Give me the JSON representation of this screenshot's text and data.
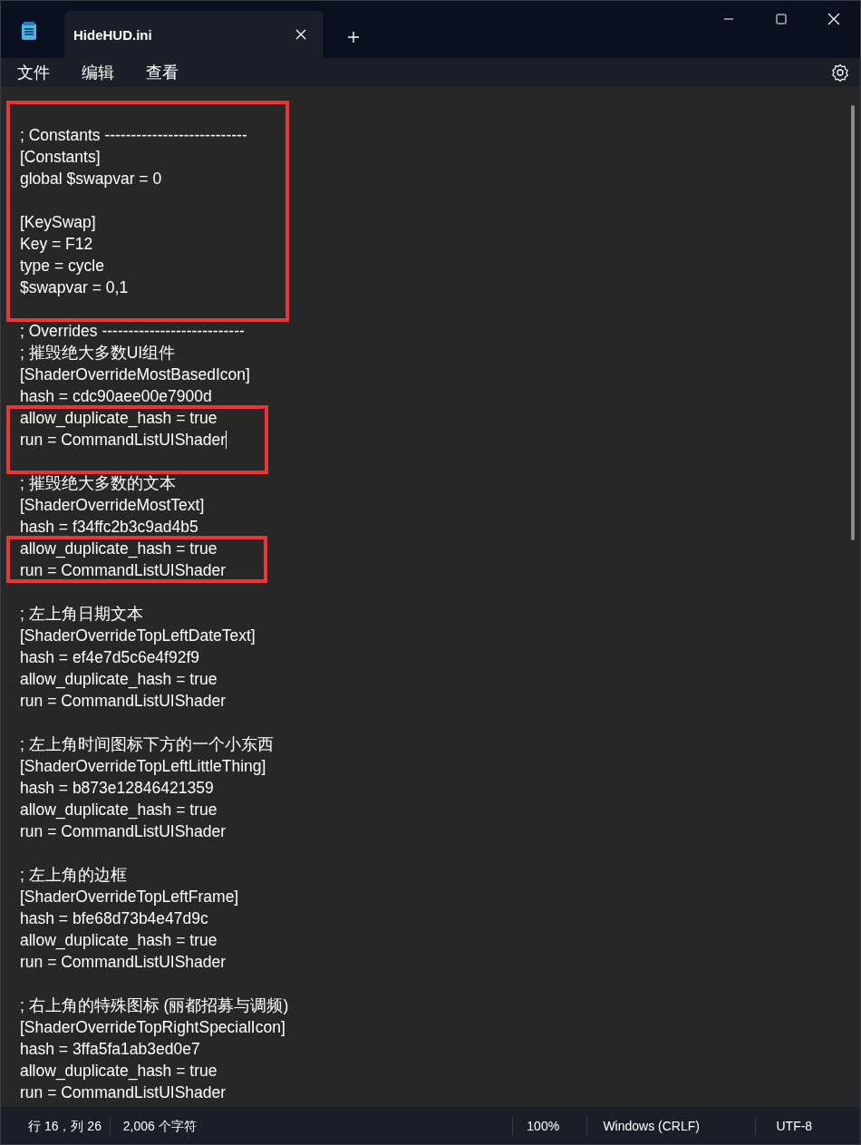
{
  "window": {
    "tabs": [
      {
        "label": "HideHUD.ini",
        "selected": true
      }
    ]
  },
  "menu": [
    "文件",
    "编辑",
    "查看"
  ],
  "editor": {
    "blocks": [
      {
        "highlighted": true,
        "lines": [
          {
            "kind": "blank"
          },
          {
            "kind": "text",
            "text": "; Constants ---------------------------"
          },
          {
            "kind": "text",
            "text": "[Constants]"
          },
          {
            "kind": "text",
            "text": "global $swapvar = 0"
          },
          {
            "kind": "blank"
          },
          {
            "kind": "text",
            "text": "[KeySwap]"
          },
          {
            "kind": "text",
            "text": "Key = F12"
          },
          {
            "kind": "text",
            "text": "type = cycle"
          },
          {
            "kind": "text",
            "text": "$swapvar = 0,1"
          },
          {
            "kind": "blank"
          }
        ]
      },
      {
        "highlighted": false,
        "lines": [
          {
            "kind": "text",
            "text": "; Overrides ---------------------------"
          },
          {
            "kind": "text",
            "text": "; 摧毁绝大多数UI组件"
          },
          {
            "kind": "text",
            "text": "[ShaderOverrideMostBasedIcon]"
          },
          {
            "kind": "text",
            "text": "hash = cdc90aee00e7900d"
          }
        ]
      },
      {
        "highlighted": true,
        "lines": [
          {
            "kind": "text",
            "text": "allow_duplicate_hash = true"
          },
          {
            "kind": "text",
            "text": "run = CommandListUIShader",
            "caret": true
          },
          {
            "kind": "blank"
          }
        ]
      },
      {
        "highlighted": false,
        "lines": [
          {
            "kind": "text",
            "text": "; 摧毁绝大多数的文本"
          },
          {
            "kind": "text",
            "text": "[ShaderOverrideMostText]"
          },
          {
            "kind": "text",
            "text": "hash = f34ffc2b3c9ad4b5"
          }
        ]
      },
      {
        "highlighted": true,
        "lines": [
          {
            "kind": "text",
            "text": "allow_duplicate_hash = true"
          },
          {
            "kind": "text",
            "text": "run = CommandListUIShader"
          }
        ]
      },
      {
        "highlighted": false,
        "lines": [
          {
            "kind": "blank"
          },
          {
            "kind": "text",
            "text": "; 左上角日期文本"
          },
          {
            "kind": "text",
            "text": "[ShaderOverrideTopLeftDateText]"
          },
          {
            "kind": "text",
            "text": "hash = ef4e7d5c6e4f92f9"
          },
          {
            "kind": "text",
            "text": "allow_duplicate_hash = true"
          },
          {
            "kind": "text",
            "text": "run = CommandListUIShader"
          },
          {
            "kind": "blank"
          },
          {
            "kind": "text",
            "text": "; 左上角时间图标下方的一个小东西"
          },
          {
            "kind": "text",
            "text": "[ShaderOverrideTopLeftLittleThing]"
          },
          {
            "kind": "text",
            "text": "hash = b873e12846421359"
          },
          {
            "kind": "text",
            "text": "allow_duplicate_hash = true"
          },
          {
            "kind": "text",
            "text": "run = CommandListUIShader"
          },
          {
            "kind": "blank"
          },
          {
            "kind": "text",
            "text": "; 左上角的边框"
          },
          {
            "kind": "text",
            "text": "[ShaderOverrideTopLeftFrame]"
          },
          {
            "kind": "text",
            "text": "hash = bfe68d73b4e47d9c"
          },
          {
            "kind": "text",
            "text": "allow_duplicate_hash = true"
          },
          {
            "kind": "text",
            "text": "run = CommandListUIShader"
          },
          {
            "kind": "blank"
          },
          {
            "kind": "text",
            "text": "; 右上角的特殊图标 (丽都招募与调频)"
          },
          {
            "kind": "text",
            "text": "[ShaderOverrideTopRightSpecialIcon]"
          },
          {
            "kind": "text",
            "text": "hash = 3ffa5fa1ab3ed0e7"
          },
          {
            "kind": "text",
            "text": "allow_duplicate_hash = true"
          },
          {
            "kind": "text",
            "text": "run = CommandListUIShader"
          }
        ]
      }
    ]
  },
  "status_bar": {
    "position": "行 16，列 26",
    "count": "2,006 个字符",
    "zoom": "100%",
    "line_ending": "Windows (CRLF)",
    "encoding": "UTF-8"
  }
}
